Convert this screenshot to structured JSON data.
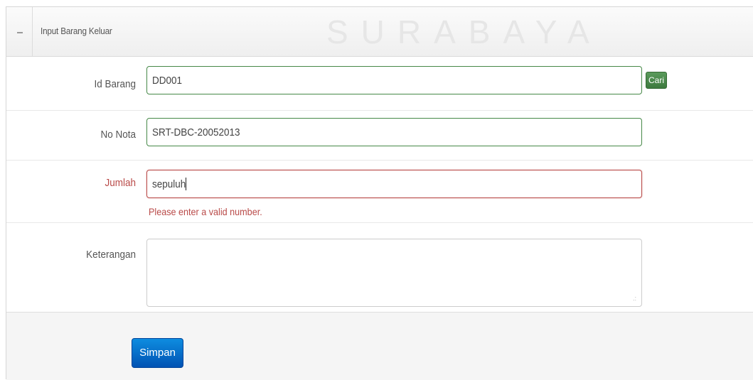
{
  "header": {
    "title": "Input Barang Keluar",
    "watermark": "SURABAYA",
    "collapse_icon": "minus-icon"
  },
  "form": {
    "id_barang": {
      "label": "Id Barang",
      "value": "DD001",
      "state": "success",
      "search_button": "Cari"
    },
    "no_nota": {
      "label": "No Nota",
      "value": "SRT-DBC-20052013",
      "state": "success"
    },
    "jumlah": {
      "label": "Jumlah",
      "value": "sepuluh",
      "state": "error",
      "error_message": "Please enter a valid number."
    },
    "keterangan": {
      "label": "Keterangan",
      "value": "",
      "resize_icon": "resize-grip-icon"
    }
  },
  "actions": {
    "submit_label": "Simpan"
  },
  "colors": {
    "success": "#468847",
    "error": "#b94a48",
    "primary": "#0070c9"
  }
}
